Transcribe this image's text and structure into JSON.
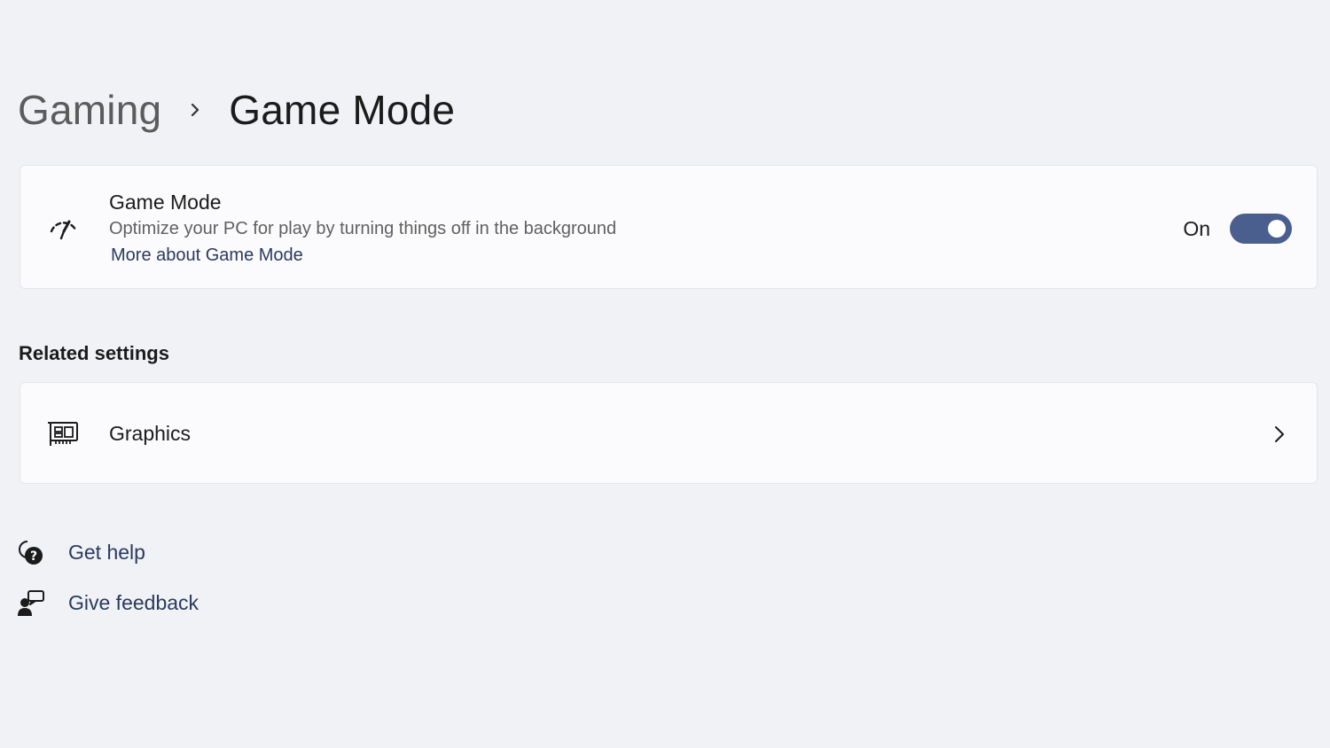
{
  "breadcrumb": {
    "parent": "Gaming",
    "current": "Game Mode"
  },
  "game_mode_card": {
    "icon": "game-mode-gauge-icon",
    "title": "Game Mode",
    "description": "Optimize your PC for play by turning things off in the background",
    "link": "More about Game Mode",
    "toggle_state_label": "On",
    "toggle_on": true
  },
  "related": {
    "heading": "Related settings",
    "items": [
      {
        "icon": "graphics-card-icon",
        "label": "Graphics"
      }
    ]
  },
  "footer": {
    "get_help": "Get help",
    "give_feedback": "Give feedback"
  },
  "colors": {
    "background": "#f0f2f6",
    "card": "#fbfbfd",
    "accent": "#4b5f8f",
    "link": "#2b3a5c"
  }
}
